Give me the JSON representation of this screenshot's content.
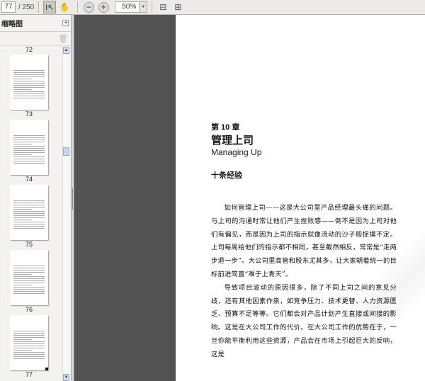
{
  "toolbar": {
    "current_page": "77",
    "total_pages": "/ 250",
    "zoom": "50%",
    "icons": [
      "select-tool-icon",
      "hand-tool-icon",
      "zoom-out-icon",
      "zoom-in-icon",
      "fit-width-icon",
      "fit-page-icon"
    ]
  },
  "sidebar": {
    "title": "缩略图",
    "thumbnails": [
      {
        "label": "72"
      },
      {
        "label": "73"
      },
      {
        "label": "74"
      },
      {
        "label": "75"
      },
      {
        "label": "76"
      },
      {
        "label": "77"
      }
    ]
  },
  "page": {
    "chapter_number": "第 10 章",
    "chapter_title": "管理上司",
    "chapter_title_en": "Managing Up",
    "section_title": "十条经验",
    "paragraphs": [
      "如何管理上司——这是大公司里产品经理最头痛的问题。与上司的沟通时常让他们产生挫败感——倒不是因为上司对他们有偏见，而是因为上司的指示就像流动的沙子般捉摸不定。上司每周给他们的指示都不相同，甚至截然相反，常常是“走两步退一步”。大公司里高管和股东尤其多，让大家朝着统一的目标前进简直“难于上青天”。",
      "导致项目波动的原因很多，除了不同上司之间的意见分歧，还有其他因素作祟，如竞争压力、技术更替、人力资源匮乏、预算不足等等。它们都会对产品计划产生直接或间接的影响。这是在大公司工作的代价。在大公司工作的优势在于，一旦你能平衡利用这些资源，产品会在市场上引起巨大的反响，这是"
    ]
  }
}
